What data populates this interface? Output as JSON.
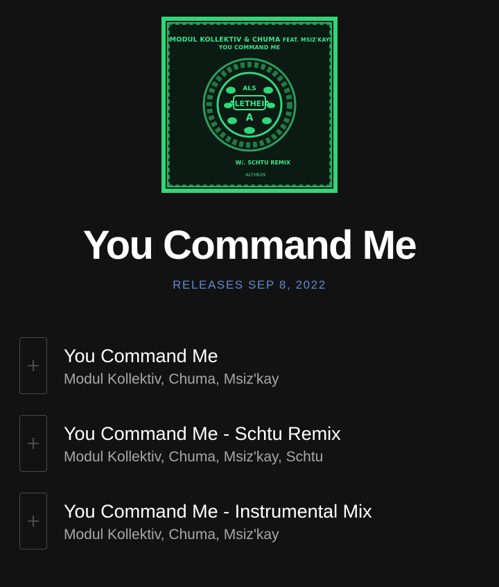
{
  "album": {
    "cover": {
      "artists_line": "MODUL KOLLEKTIV & CHUMA",
      "feat_line": "FEAT. MSIZ'KAY",
      "title_line": "YOU COMMAND ME",
      "remix_line": "W/. SCHTU REMIX",
      "catalog": "ALTHR29",
      "accent": "#2fd67a"
    },
    "title": "You Command Me",
    "release": "RELEASES SEP 8, 2022"
  },
  "tracks": [
    {
      "name": "You Command Me",
      "artists": "Modul Kollektiv, Chuma, Msiz'kay",
      "icon": "plus-icon"
    },
    {
      "name": "You Command Me - Schtu Remix",
      "artists": "Modul Kollektiv, Chuma, Msiz'kay, Schtu",
      "icon": "plus-icon"
    },
    {
      "name": "You Command Me - Instrumental Mix",
      "artists": "Modul Kollektiv, Chuma, Msiz'kay",
      "icon": "plus-icon"
    }
  ],
  "colors": {
    "background": "#121212",
    "release_text": "#5b8ccf",
    "secondary_text": "#a7a7a7"
  }
}
